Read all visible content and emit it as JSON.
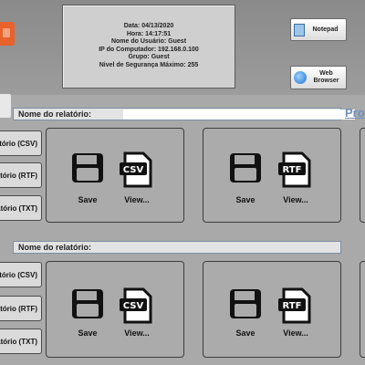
{
  "info": {
    "date": "Data: 04/13/2020",
    "time": "Hora: 14:17:51",
    "user": "Nome do Usuário: Guest",
    "ip": "IP do Computador: 192.168.0.100",
    "group": "Grupo: Guest",
    "security": "Nivel de Segurança Máximo: 255"
  },
  "toolbar": {
    "notepad": "Notepad",
    "web1": "Web",
    "web2": "Browser"
  },
  "sections": [
    {
      "title": "Nome do relatório:",
      "link": "Pro",
      "side_buttons": [
        "latório (CSV)",
        "latório (RTF)",
        "latório (TXT)"
      ],
      "panels": [
        {
          "save": "Save",
          "view": "View...",
          "format": "CSV"
        },
        {
          "save": "Save",
          "view": "View...",
          "format": "RTF"
        }
      ]
    },
    {
      "title": "Nome do relatório:",
      "side_buttons": [
        "latório (CSV)",
        "latório (RTF)",
        "latório (TXT)"
      ],
      "panels": [
        {
          "save": "Save",
          "view": "View...",
          "format": "CSV"
        },
        {
          "save": "Save",
          "view": "View...",
          "format": "RTF"
        }
      ]
    }
  ],
  "colors": {
    "accent": "#e8622c",
    "link": "#6e8fb8"
  }
}
